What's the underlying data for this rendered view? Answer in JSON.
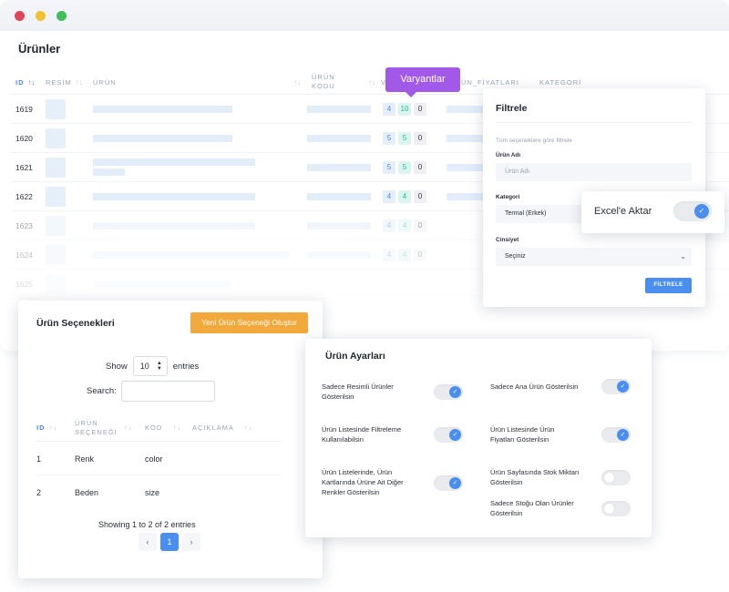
{
  "window": {
    "title": "Ürünler"
  },
  "products_table": {
    "headers": [
      "ID",
      "RESİM",
      "ÜRÜN",
      "ÜRÜN KODU",
      "V",
      "ÜN_FİYATLARI",
      "KATEGORİ"
    ],
    "rows": [
      {
        "id": "1619",
        "counts": [
          "4",
          "10",
          "0"
        ]
      },
      {
        "id": "1620",
        "counts": [
          "5",
          "5",
          "0"
        ]
      },
      {
        "id": "1621",
        "counts": [
          "5",
          "5",
          "0"
        ]
      },
      {
        "id": "1622",
        "counts": [
          "4",
          "4",
          "0"
        ]
      },
      {
        "id": "1623",
        "counts": [
          "4",
          "4",
          "0"
        ]
      },
      {
        "id": "1624",
        "counts": [
          "4",
          "4",
          "0"
        ]
      },
      {
        "id": "1625",
        "counts": [
          "",
          "",
          ""
        ]
      }
    ]
  },
  "tooltip": {
    "label": "Varyantlar"
  },
  "filter": {
    "title": "Filtrele",
    "hint": "Tüm seçeneklere göre filtrele",
    "product_name_label": "Ürün Adı",
    "product_name_placeholder": "Ürün Adı",
    "category_label": "Kategori",
    "category_value": "Termal (Erkek)",
    "gender_label": "Cinsiyet",
    "gender_value": "Seçiniz",
    "button": "FİLTRELE"
  },
  "excel": {
    "label": "Excel'e Aktar",
    "enabled": true
  },
  "options": {
    "title": "Ürün Seçenekleri",
    "new_button": "Yeni Ürün Seçeneği Oluştur",
    "show_label": "Show",
    "entries_value": "10",
    "entries_label": "entries",
    "search_label": "Search:",
    "headers": {
      "id": "ID",
      "name_1": "ÜRÜN",
      "name_2": "SEÇENEĞİ",
      "code": "KOD",
      "desc": "AÇIKLAMA"
    },
    "rows": [
      {
        "id": "1",
        "name": "Renk",
        "code": "color"
      },
      {
        "id": "2",
        "name": "Beden",
        "code": "size"
      }
    ],
    "showing": "Showing 1 to 2 of 2 entries",
    "pager": {
      "prev": "‹",
      "page": "1",
      "next": "›"
    }
  },
  "settings": {
    "title": "Ürün Ayarları",
    "items": [
      {
        "label_1": "Sadece Resimli Ürünler",
        "label_2": "Gösterilsin",
        "label_3": "",
        "on": true
      },
      {
        "label_1": "Sadece Ana Ürün Gösterilsin",
        "label_2": "",
        "label_3": "",
        "on": true
      },
      {
        "label_1": "Ürün Listesinde Filtreleme",
        "label_2": "Kullanılabilsin",
        "label_3": "",
        "on": true
      },
      {
        "label_1": "Ürün Listesinde Ürün",
        "label_2": "Fiyatları Gösterilsin",
        "label_3": "",
        "on": true
      },
      {
        "label_1": "Ürün Listelerinde, Ürün",
        "label_2": "Kartlarında Ürüne Ait Diğer",
        "label_3": "Renkler Gösterilsin",
        "on": true
      },
      {
        "label_1": "Ürün Sayfasında Stok Miktarı",
        "label_2": "Gösterilsin",
        "label_3": "",
        "on": false
      },
      {
        "label_1": "Sadece Stoğu Olan Ürünler",
        "label_2": "Gösterilsin",
        "label_3": "",
        "on": false
      }
    ]
  },
  "colors": {
    "accent": "#4a8ef0",
    "purple": "#a259e8",
    "orange": "#f2a93b"
  },
  "icons": {
    "sort": "sort-arrows-icon",
    "check": "check-icon",
    "chevron": "chevron-down-icon"
  }
}
